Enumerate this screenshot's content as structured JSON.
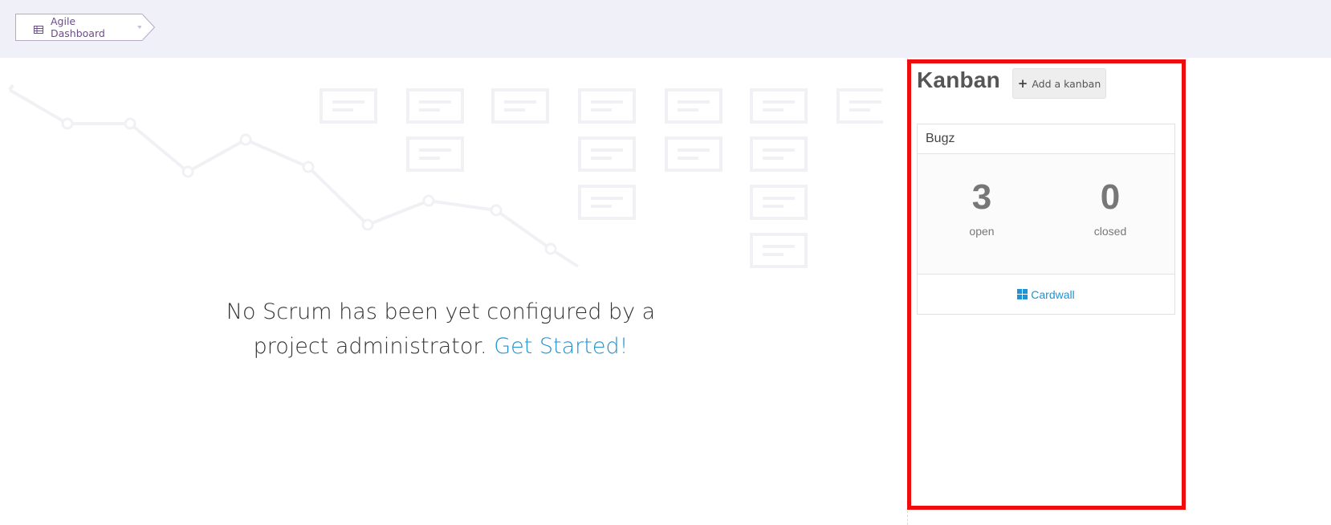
{
  "breadcrumb": {
    "label": "Agile Dashboard",
    "icon": "table-icon"
  },
  "scrum": {
    "message_line1": "No Scrum has been yet configured by a",
    "message_line2": "project administrator.",
    "get_started": "Get Started!"
  },
  "kanban": {
    "title": "Kanban",
    "add_button": "Add a kanban",
    "add_icon": "plus-icon",
    "card": {
      "name": "Bugz",
      "open_count": "3",
      "open_label": "open",
      "closed_count": "0",
      "closed_label": "closed",
      "cardwall_label": "Cardwall",
      "cardwall_icon": "grid-icon"
    }
  },
  "colors": {
    "accent": "#1f93d3",
    "breadcrumb_text": "#6c4d86",
    "highlight_border": "#ee0c0c",
    "topbar_bg": "#eff0f8"
  }
}
